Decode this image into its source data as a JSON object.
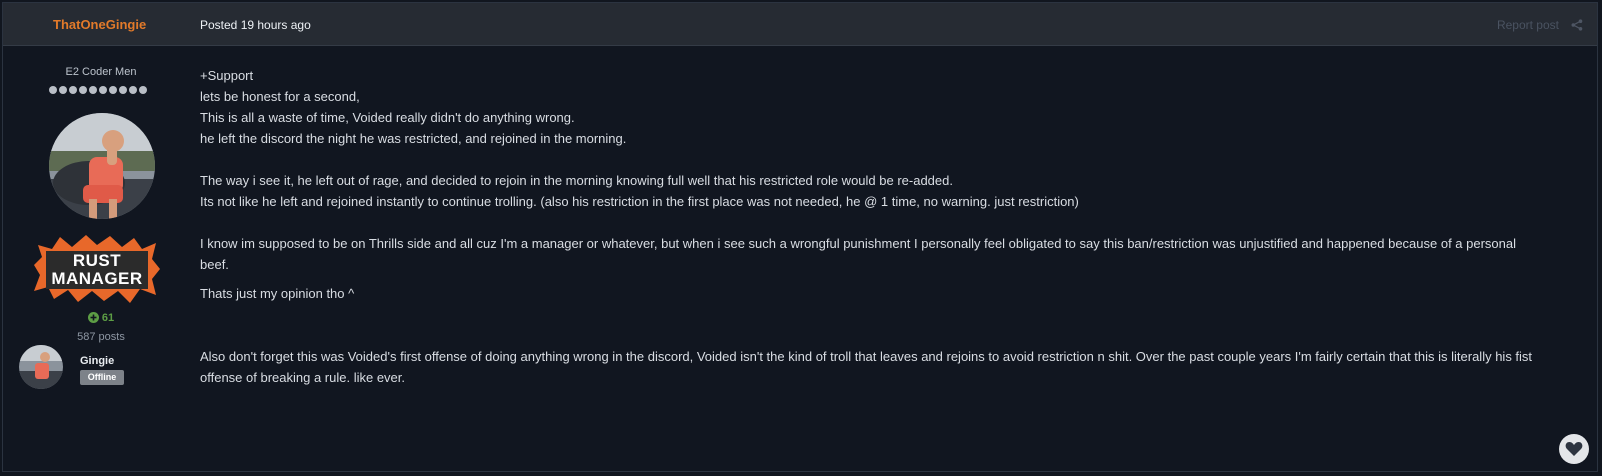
{
  "header": {
    "author": "ThatOneGingie",
    "posted": "Posted 19 hours ago",
    "report_label": "Report post",
    "share_icon": "share-icon"
  },
  "author_panel": {
    "title": "E2 Coder Men",
    "pips": 10,
    "rank_line1": "RUST",
    "rank_line2": "MANAGER",
    "reputation": "61",
    "reputation_color": "#5d9e45",
    "post_count": "587 posts",
    "linked_name": "Gingie",
    "status": "Offline"
  },
  "content": {
    "lines": [
      "+Support",
      "lets be honest for a second,",
      "This is all a waste of time, Voided really didn't do anything wrong.",
      "he left the discord the night he was restricted, and rejoined in the morning.",
      "The way i see it, he left out of rage, and decided to rejoin in the morning knowing full well that his restricted role would be re-added.",
      "Its not like he left and rejoined instantly to continue trolling. (also his restriction in the first place was not needed, he @ 1 time, no warning. just restriction)",
      "I know im supposed to be on Thrills side and all cuz I'm a manager or whatever, but when i see such a wrongful punishment I personally feel obligated to say this ban/restriction was unjustified and happened because of a personal beef.",
      "Thats just my opinion tho ^",
      "Also don't forget this was Voided's first offense of doing anything wrong in the discord, Voided isn't the kind of troll that leaves and rejoins to avoid restriction n shit. Over the past couple years I'm fairly certain that this is literally his fist offense of breaking a rule. like ever."
    ]
  },
  "colors": {
    "author": "#e27a2a",
    "background": "#11161f",
    "header": "#262b33",
    "rank_badge": "#e8682a"
  }
}
